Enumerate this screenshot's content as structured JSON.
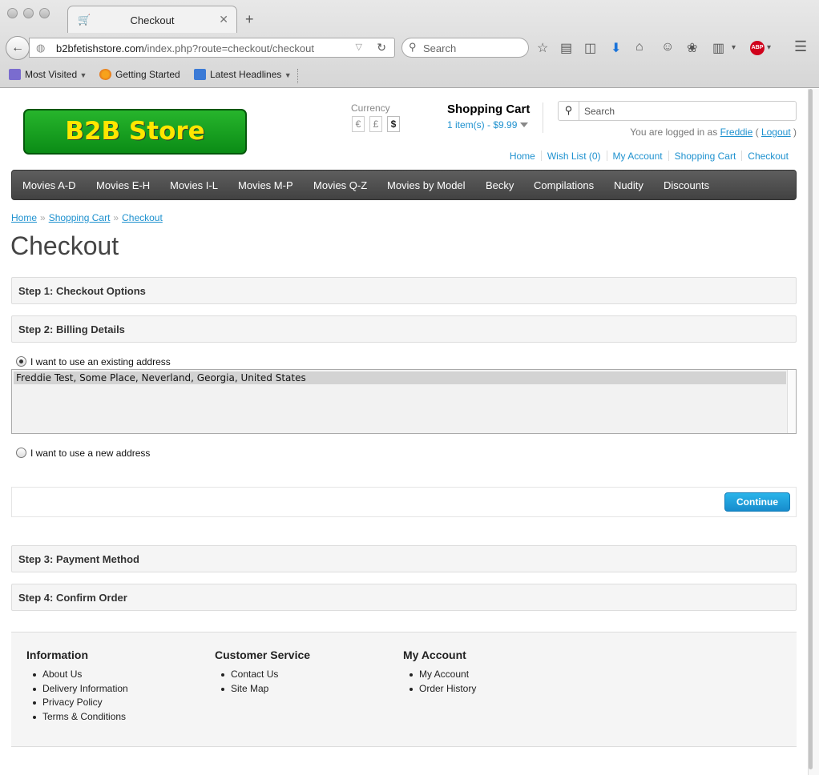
{
  "browser": {
    "tab_title": "Checkout",
    "url_host": "b2bfetishstore.com",
    "url_path": "/index.php?route=checkout/checkout",
    "search_placeholder": "Search",
    "bookmarks": [
      "Most Visited",
      "Getting Started",
      "Latest Headlines"
    ]
  },
  "header": {
    "logo_text": "B2B Store",
    "currency_label": "Currency",
    "currencies": [
      "€",
      "£",
      "$"
    ],
    "cart_title": "Shopping Cart",
    "cart_total": "1 item(s) - $9.99",
    "search_placeholder": "Search",
    "logged_in_prefix": "You are logged in as",
    "username": "Freddie",
    "logout_label": "Logout",
    "paren_open": "(",
    "paren_close": ")",
    "top_links": [
      "Home",
      "Wish List (0)",
      "My Account",
      "Shopping Cart",
      "Checkout"
    ]
  },
  "menu": [
    "Movies A-D",
    "Movies E-H",
    "Movies I-L",
    "Movies M-P",
    "Movies Q-Z",
    "Movies by Model",
    "Becky",
    "Compilations",
    "Nudity",
    "Discounts"
  ],
  "breadcrumb": [
    "Home",
    "Shopping Cart",
    "Checkout"
  ],
  "breadcrumb_sep": "»",
  "page_title": "Checkout",
  "steps": {
    "step1": "Step 1: Checkout Options",
    "step2": "Step 2: Billing Details",
    "step3": "Step 3: Payment Method",
    "step4": "Step 4: Confirm Order"
  },
  "billing": {
    "existing_label": "I want to use an existing address",
    "selected_address": "Freddie Test, Some Place, Neverland, Georgia, United States",
    "new_label": "I want to use a new address",
    "continue_label": "Continue"
  },
  "footer": {
    "information": {
      "title": "Information",
      "items": [
        "About Us",
        "Delivery Information",
        "Privacy Policy",
        "Terms & Conditions"
      ]
    },
    "customer_service": {
      "title": "Customer Service",
      "items": [
        "Contact Us",
        "Site Map"
      ]
    },
    "my_account": {
      "title": "My Account",
      "items": [
        "My Account",
        "Order History"
      ]
    }
  },
  "colors": {
    "link": "#1e91cf",
    "menu_bg": "#4f4f4f",
    "logo_green": "#1aa321",
    "logo_text": "#ffe600",
    "button": "#1e9fdd"
  }
}
